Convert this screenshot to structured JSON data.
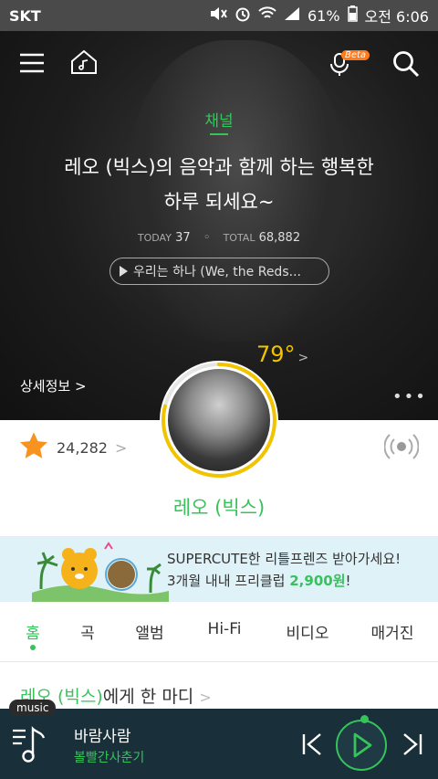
{
  "status_bar": {
    "carrier": "SKT",
    "battery": "61%",
    "time": "오전 6:06"
  },
  "header": {
    "beta_label": "Beta"
  },
  "hero": {
    "channel_label": "채널",
    "headline_line1": "레오 (빅스)의 음악과 함께 하는 행복한",
    "headline_line2": "하루 되세요~",
    "today_label": "TODAY",
    "today_value": "37",
    "total_label": "TOTAL",
    "total_value": "68,882",
    "now_playing": "우리는 하나 (We, the Reds...",
    "detail_link": "상세정보 >",
    "temperature": "79°",
    "more": "•••"
  },
  "profile": {
    "fan_count": "24,282",
    "artist_name": "레오 (빅스)",
    "temperature_progress": 0.79
  },
  "banner": {
    "line1": "SUPERCUTE한 리틀프렌즈 받아가세요!",
    "line2_prefix": "3개월 내내 프리클럽 ",
    "line2_price": "2,900원",
    "line2_suffix": "!"
  },
  "tabs": [
    "홈",
    "곡",
    "앨범",
    "Hi-Fi",
    "비디오",
    "매거진"
  ],
  "active_tab": "홈",
  "comment_section": {
    "artist": "레오 (빅스)",
    "suffix": "에게 한 마디",
    "chevron": ">"
  },
  "player": {
    "tag": "music",
    "song_title": "바람사람",
    "song_artist": "볼빨간사춘기"
  },
  "colors": {
    "accent": "#35c35a",
    "temperature": "#f2c400",
    "player_bg": "#19303a",
    "banner_bg": "#dff2f8"
  }
}
